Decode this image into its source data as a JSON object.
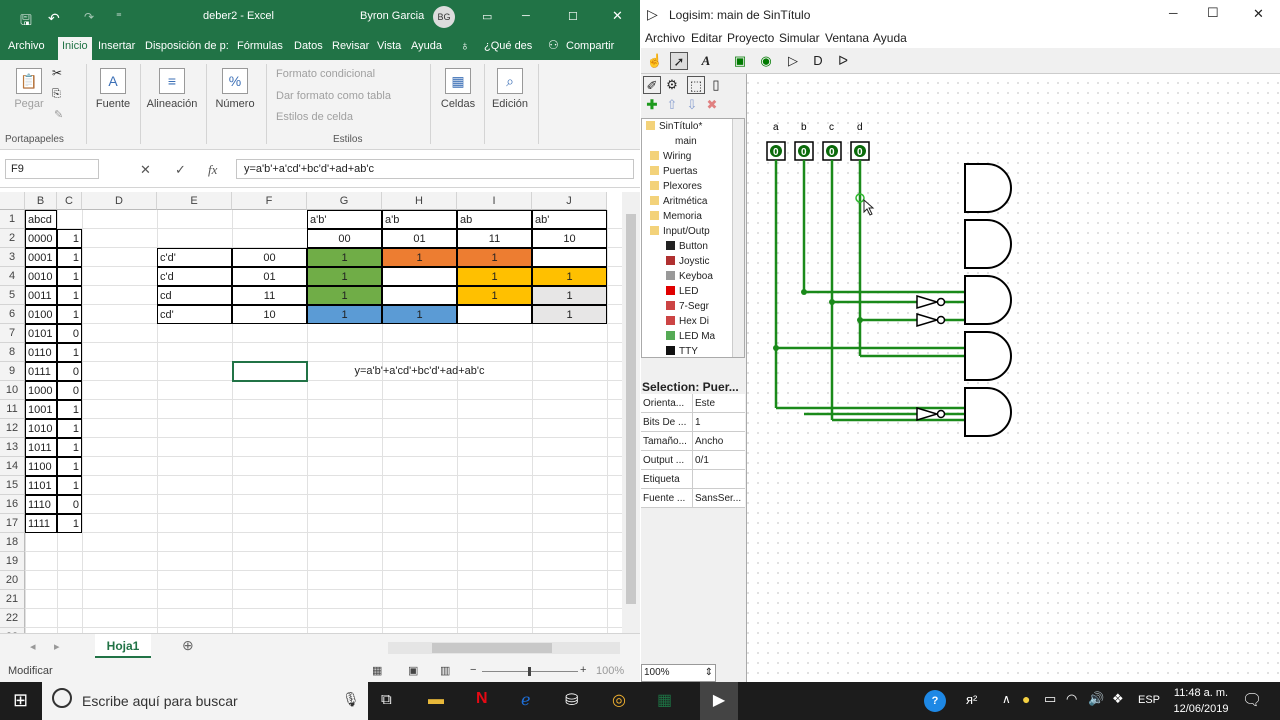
{
  "excel": {
    "title": "deber2  -  Excel",
    "user": "Byron Garcia",
    "user_initials": "BG",
    "tabs": [
      "Archivo",
      "Inicio",
      "Insertar",
      "Disposición de p:",
      "Fórmulas",
      "Datos",
      "Revisar",
      "Vista",
      "Ayuda"
    ],
    "tell_me": "¿Qué des",
    "share": "Compartir",
    "ribbon": {
      "pegar": "Pegar",
      "portapapeles": "Portapapeles",
      "fuente": "Fuente",
      "alineacion": "Alineación",
      "numero": "Número",
      "formato_condicional": "Formato condicional",
      "dar_formato": "Dar formato como tabla",
      "estilos_celda": "Estilos de celda",
      "estilos": "Estilos",
      "celdas": "Celdas",
      "edicion": "Edición"
    },
    "name_box": "F9",
    "formula": "y=a'b'+a'cd'+bc'd'+ad+ab'c",
    "columns": [
      "B",
      "C",
      "D",
      "E",
      "F",
      "G",
      "H",
      "I",
      "J"
    ],
    "rows": [
      "1",
      "2",
      "3",
      "4",
      "5",
      "6",
      "7",
      "8",
      "9",
      "10",
      "11",
      "12",
      "13",
      "14",
      "15",
      "16",
      "17",
      "18",
      "19",
      "20",
      "21",
      "22",
      "23"
    ],
    "truth_header": "abcd",
    "truth_inputs": [
      "0000",
      "0001",
      "0010",
      "0011",
      "0100",
      "0101",
      "0110",
      "0111",
      "1000",
      "1001",
      "1010",
      "1011",
      "1100",
      "1101",
      "1110",
      "1111"
    ],
    "truth_outputs": [
      "1",
      "1",
      "1",
      "1",
      "1",
      "0",
      "1",
      "0",
      "0",
      "1",
      "1",
      "1",
      "1",
      "1",
      "0",
      "1"
    ],
    "kmap": {
      "col_vars": [
        "a'b'",
        "a'b",
        "ab",
        "ab'"
      ],
      "col_codes": [
        "00",
        "01",
        "11",
        "10"
      ],
      "row_vars": [
        "c'd'",
        "c'd",
        "cd",
        "cd'"
      ],
      "row_codes": [
        "00",
        "01",
        "11",
        "10"
      ],
      "cells": [
        [
          "1",
          "1",
          "1",
          ""
        ],
        [
          "1",
          "",
          "1",
          "1"
        ],
        [
          "1",
          "",
          "1",
          "1"
        ],
        [
          "1",
          "1",
          "",
          "1"
        ]
      ]
    },
    "expression": "y=a'b'+a'cd'+bc'd'+ad+ab'c",
    "sheet_tab": "Hoja1",
    "status": "Modificar",
    "zoom": "100%",
    "colors": {
      "green": "#70ad47",
      "orange": "#ed7d31",
      "yellow": "#ffc000",
      "blue": "#5b9bd5",
      "gray": "#e7e6e6"
    }
  },
  "logisim": {
    "title": "Logisim: main de SinTítulo",
    "menu": [
      "Archivo",
      "Editar",
      "Proyecto",
      "Simular",
      "Ventana",
      "Ayuda"
    ],
    "tree": {
      "root": "SinTítulo*",
      "main": "main",
      "folders": [
        "Wiring",
        "Puertas",
        "Plexores",
        "Aritmética",
        "Memoria",
        "Input/Outp"
      ],
      "io_items": [
        "Button",
        "Joystic",
        "Keyboa",
        "LED",
        "7-Segr",
        "Hex Di",
        "LED Ma",
        "TTY"
      ]
    },
    "selection": "Selection: Puer...",
    "attrs": [
      {
        "k": "Orienta...",
        "v": "Este"
      },
      {
        "k": "Bits De ...",
        "v": "1"
      },
      {
        "k": "Tamaño...",
        "v": "Ancho"
      },
      {
        "k": "Output ...",
        "v": "0/1"
      },
      {
        "k": "Etiqueta",
        "v": ""
      },
      {
        "k": "Fuente ...",
        "v": "SansSer..."
      }
    ],
    "pins": [
      "a",
      "b",
      "c",
      "d"
    ],
    "pin_value": "0",
    "zoom": "100%"
  },
  "taskbar": {
    "search": "Escribe aquí para buscar",
    "lang": "ESP",
    "time": "11:48 a. m.",
    "date": "12/06/2019"
  }
}
